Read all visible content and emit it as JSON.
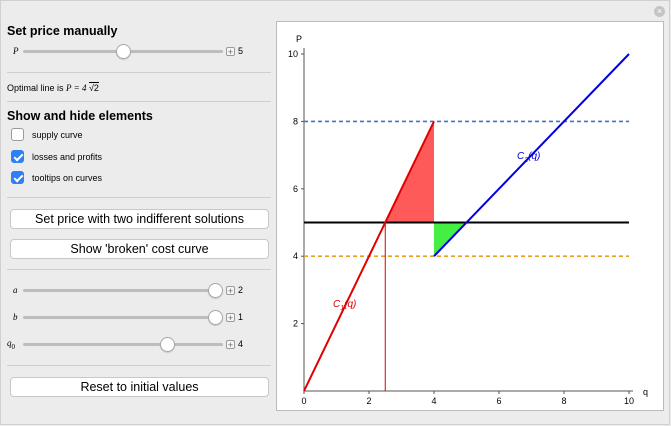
{
  "window": {
    "close_glyph": "×"
  },
  "manual": {
    "title": "Set price manually",
    "p_label": "P",
    "p_value": "5",
    "p_fraction": 0.5,
    "optimal_prefix": "Optimal line is",
    "optimal_expr": "P = 4",
    "optimal_sqrt": "√2"
  },
  "elements": {
    "title": "Show and hide elements",
    "items": [
      {
        "label": "supply curve",
        "checked": false
      },
      {
        "label": "losses and profits",
        "checked": true
      },
      {
        "label": "tooltips on curves",
        "checked": true
      }
    ]
  },
  "buttons": {
    "two_solutions": "Set price with two indifferent solutions",
    "broken": "Show 'broken' cost curve",
    "reset": "Reset to initial values"
  },
  "params": [
    {
      "label": "a",
      "value": "2",
      "fraction": 0.96
    },
    {
      "label": "b",
      "value": "1",
      "fraction": 0.96
    },
    {
      "label": "q",
      "sub": "0",
      "value": "4",
      "fraction": 0.72
    }
  ],
  "icons": {
    "plus": "+",
    "close": "close-icon"
  },
  "colors": {
    "c1": "#e00000",
    "c2": "#0000e0",
    "loss": "#ff5a5a",
    "profit": "#44ee44",
    "dash_top": "#4472c4",
    "dash_bot": "#e8a020",
    "price": "#000000"
  },
  "chart_data": {
    "type": "line",
    "xlabel": "q",
    "ylabel": "P",
    "xlim": [
      0,
      10
    ],
    "ylim": [
      0,
      10
    ],
    "xticks": [
      0,
      2,
      4,
      6,
      8,
      10
    ],
    "yticks": [
      2,
      4,
      6,
      8,
      10
    ],
    "series": [
      {
        "name": "C1(q)",
        "label_main": "C",
        "label_sub": "1",
        "label_tail": "(q)",
        "x": [
          0,
          4
        ],
        "y": [
          0,
          8
        ]
      },
      {
        "name": "C2(q)",
        "label_main": "C",
        "label_sub": "2",
        "label_tail": "(q)",
        "x": [
          4,
          10
        ],
        "y": [
          4,
          10
        ]
      }
    ],
    "price_line": 5,
    "dashed_upper": 8,
    "dashed_lower": 4,
    "loss_triangle": [
      [
        2.5,
        5
      ],
      [
        4,
        8
      ],
      [
        4,
        5
      ]
    ],
    "profit_triangle": [
      [
        4,
        4
      ],
      [
        4,
        5
      ],
      [
        5,
        5
      ]
    ],
    "drop_line_x": 2.5
  }
}
